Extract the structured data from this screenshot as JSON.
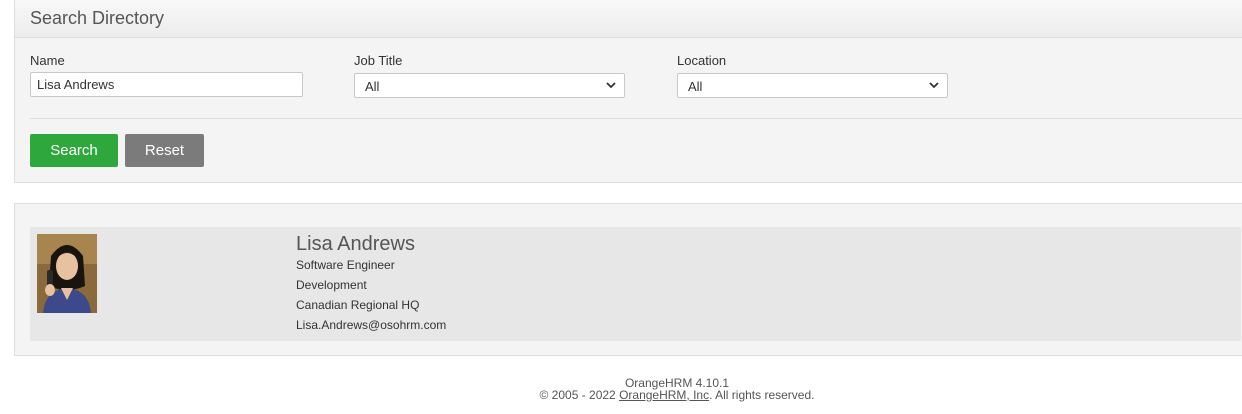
{
  "search_panel": {
    "title": "Search Directory",
    "name_label": "Name",
    "name_value": "Lisa Andrews",
    "job_title_label": "Job Title",
    "job_title_value": "All",
    "location_label": "Location",
    "location_value": "All",
    "search_button": "Search",
    "reset_button": "Reset"
  },
  "results": [
    {
      "name": "Lisa Andrews",
      "job_title": "Software Engineer",
      "department": "Development",
      "location": "Canadian Regional HQ",
      "email": "Lisa.Andrews@osohrm.com"
    }
  ],
  "footer": {
    "version": "OrangeHRM 4.10.1",
    "copyright_prefix": "© 2005 - 2022 ",
    "company_link": "OrangeHRM, Inc",
    "copyright_suffix": ". All rights reserved."
  },
  "colors": {
    "search_button": "#2ea83d",
    "reset_button": "#7b7b7b",
    "panel_bg": "#f4f4f4",
    "row_bg": "#e7e7e7"
  }
}
